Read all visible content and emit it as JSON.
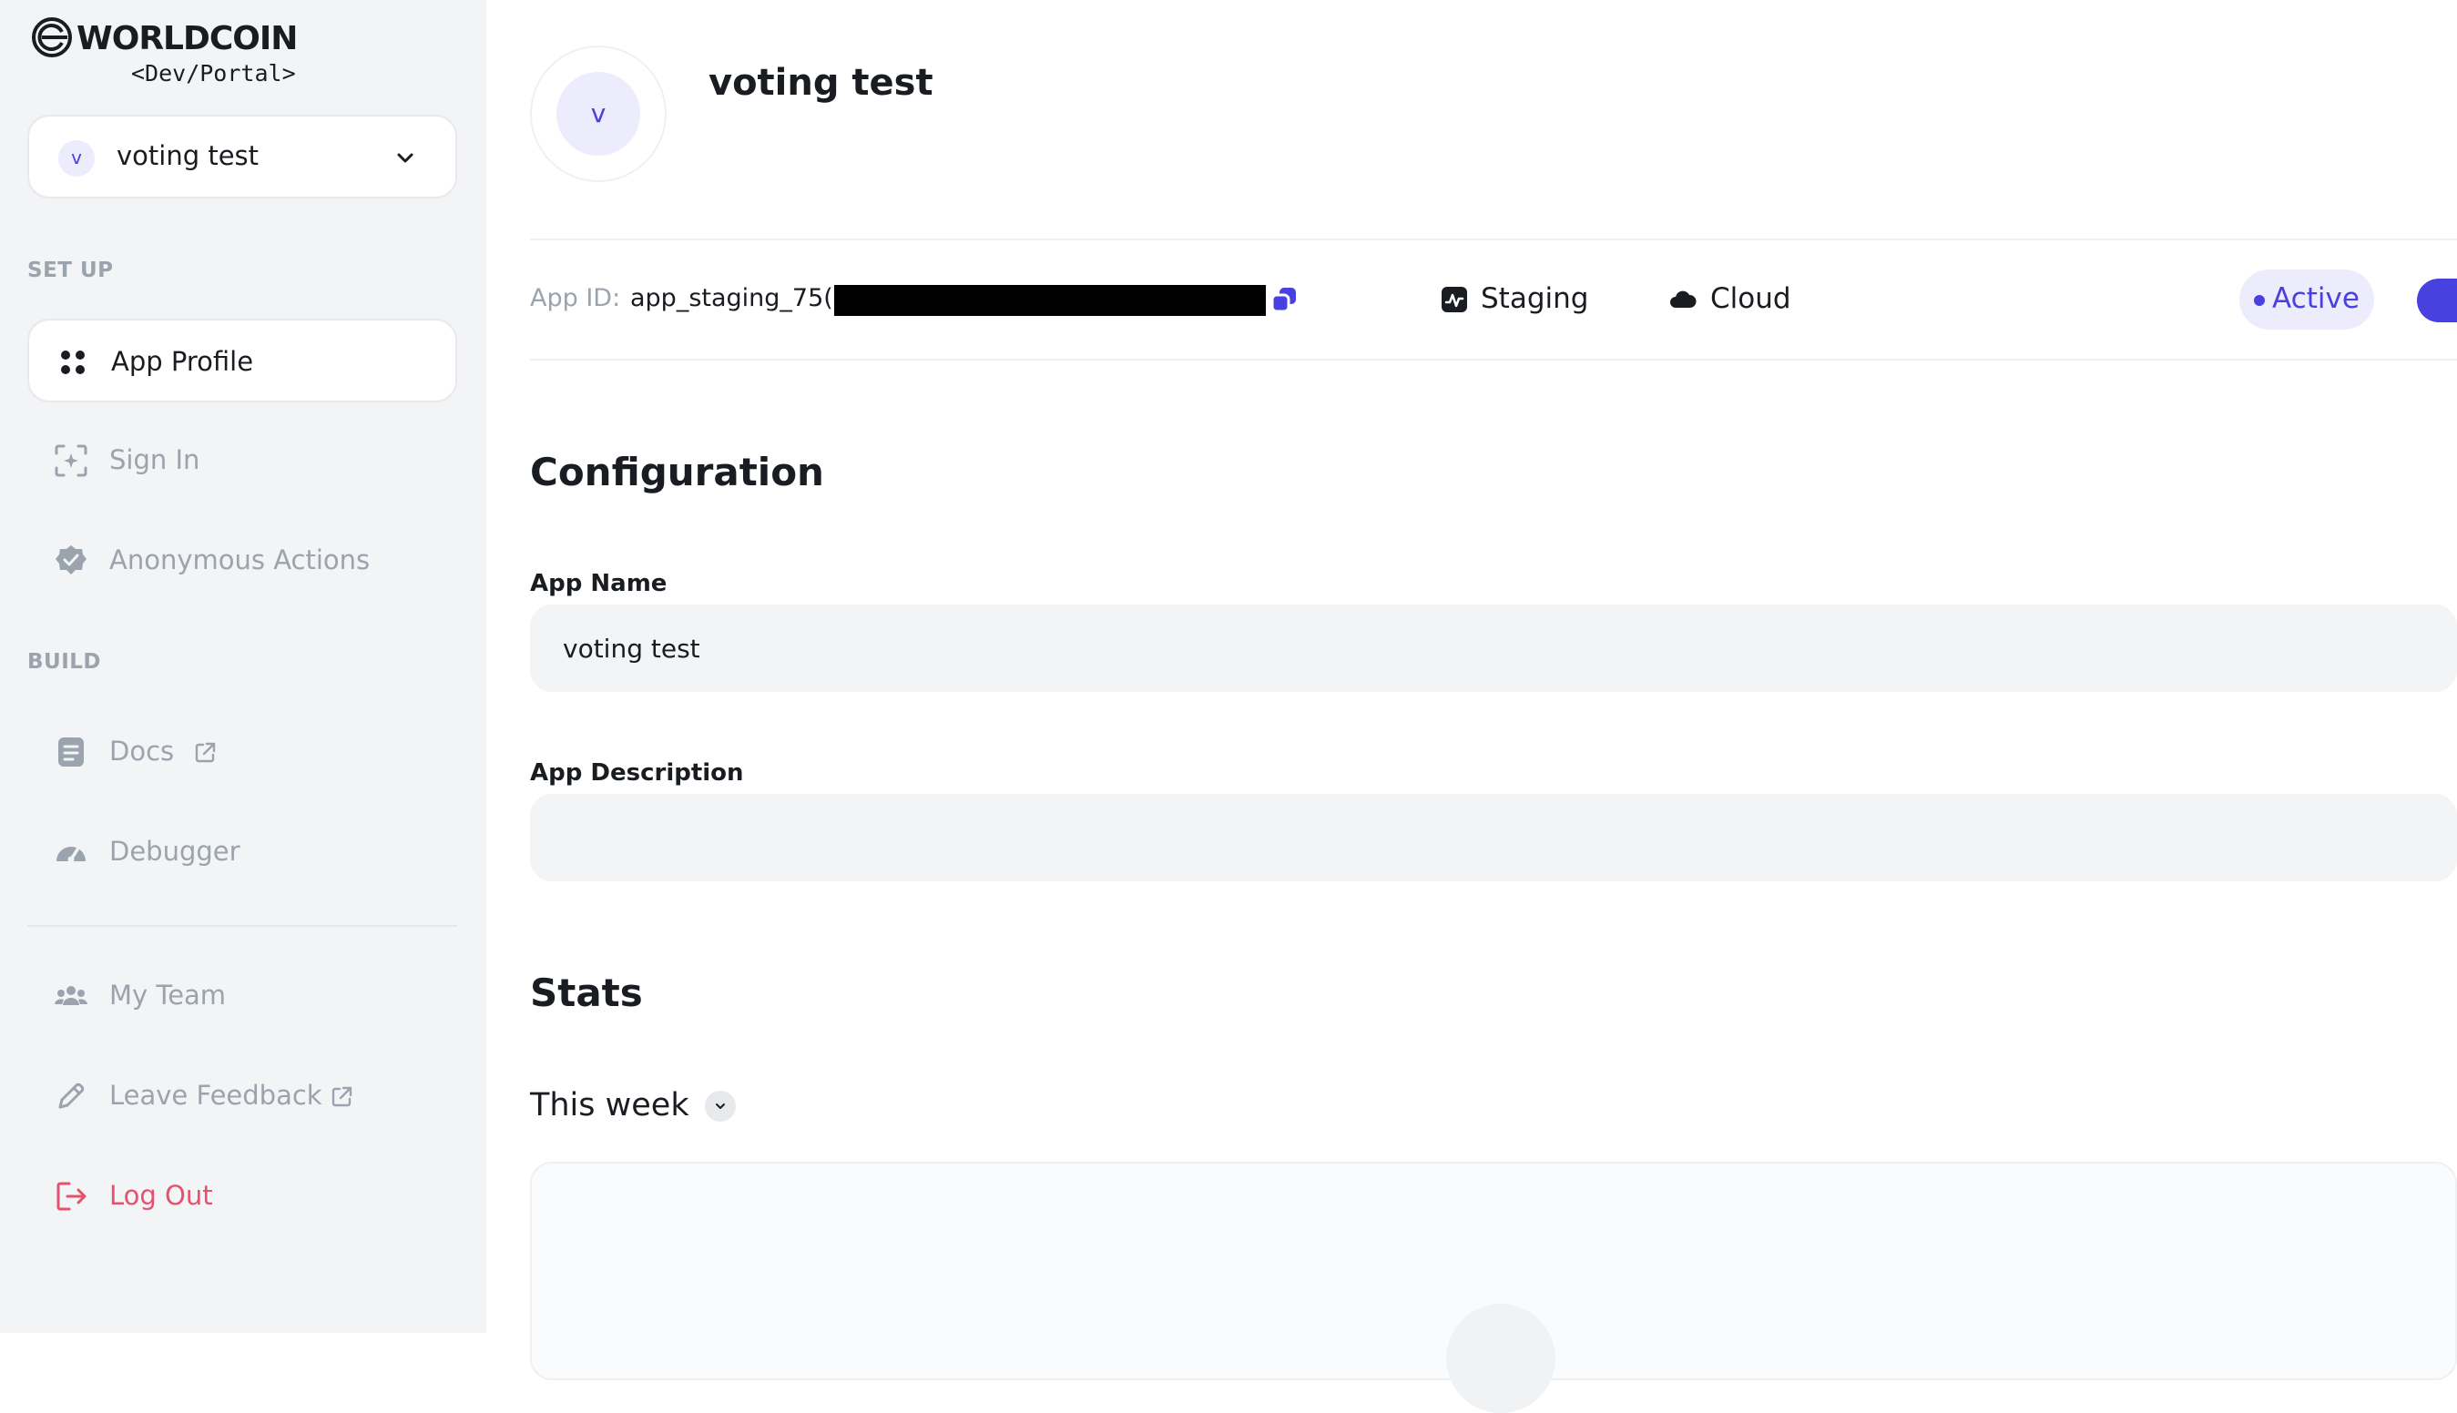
{
  "brand": {
    "wordmark": "WORLDCOIN",
    "subtitle": "<Dev/Portal>"
  },
  "app_selector": {
    "avatar_letter": "v",
    "name": "voting test"
  },
  "sidebar": {
    "section_setup": "SET UP",
    "section_build": "BUILD",
    "items": [
      {
        "label": "App Profile",
        "icon": "grid-dots-icon",
        "active": true
      },
      {
        "label": "Sign In",
        "icon": "face-scan-icon"
      },
      {
        "label": "Anonymous Actions",
        "icon": "badge-check-icon"
      },
      {
        "label": "Docs",
        "icon": "document-icon",
        "external": true
      },
      {
        "label": "Debugger",
        "icon": "gauge-icon"
      },
      {
        "label": "My Team",
        "icon": "team-icon"
      },
      {
        "label": "Leave Feedback",
        "icon": "pencil-icon",
        "external": true
      },
      {
        "label": "Log Out",
        "icon": "logout-icon"
      }
    ]
  },
  "header": {
    "avatar_letter": "v",
    "app_title": "voting test"
  },
  "info": {
    "app_id_label": "App ID:",
    "app_id_value": "app_staging_75(",
    "environment": "Staging",
    "engine": "Cloud",
    "status": "Active",
    "toggle_on": true
  },
  "configuration": {
    "title": "Configuration",
    "app_name_label": "App Name",
    "app_name_value": "voting test",
    "app_description_label": "App Description",
    "app_description_value": ""
  },
  "stats": {
    "title": "Stats",
    "period": "This week"
  },
  "colors": {
    "accent": "#4940e0",
    "accent_bg": "#ececfd",
    "sidebar_bg": "#f3f4f5",
    "muted_text": "#9ba3ae",
    "danger": "#e6526e"
  }
}
